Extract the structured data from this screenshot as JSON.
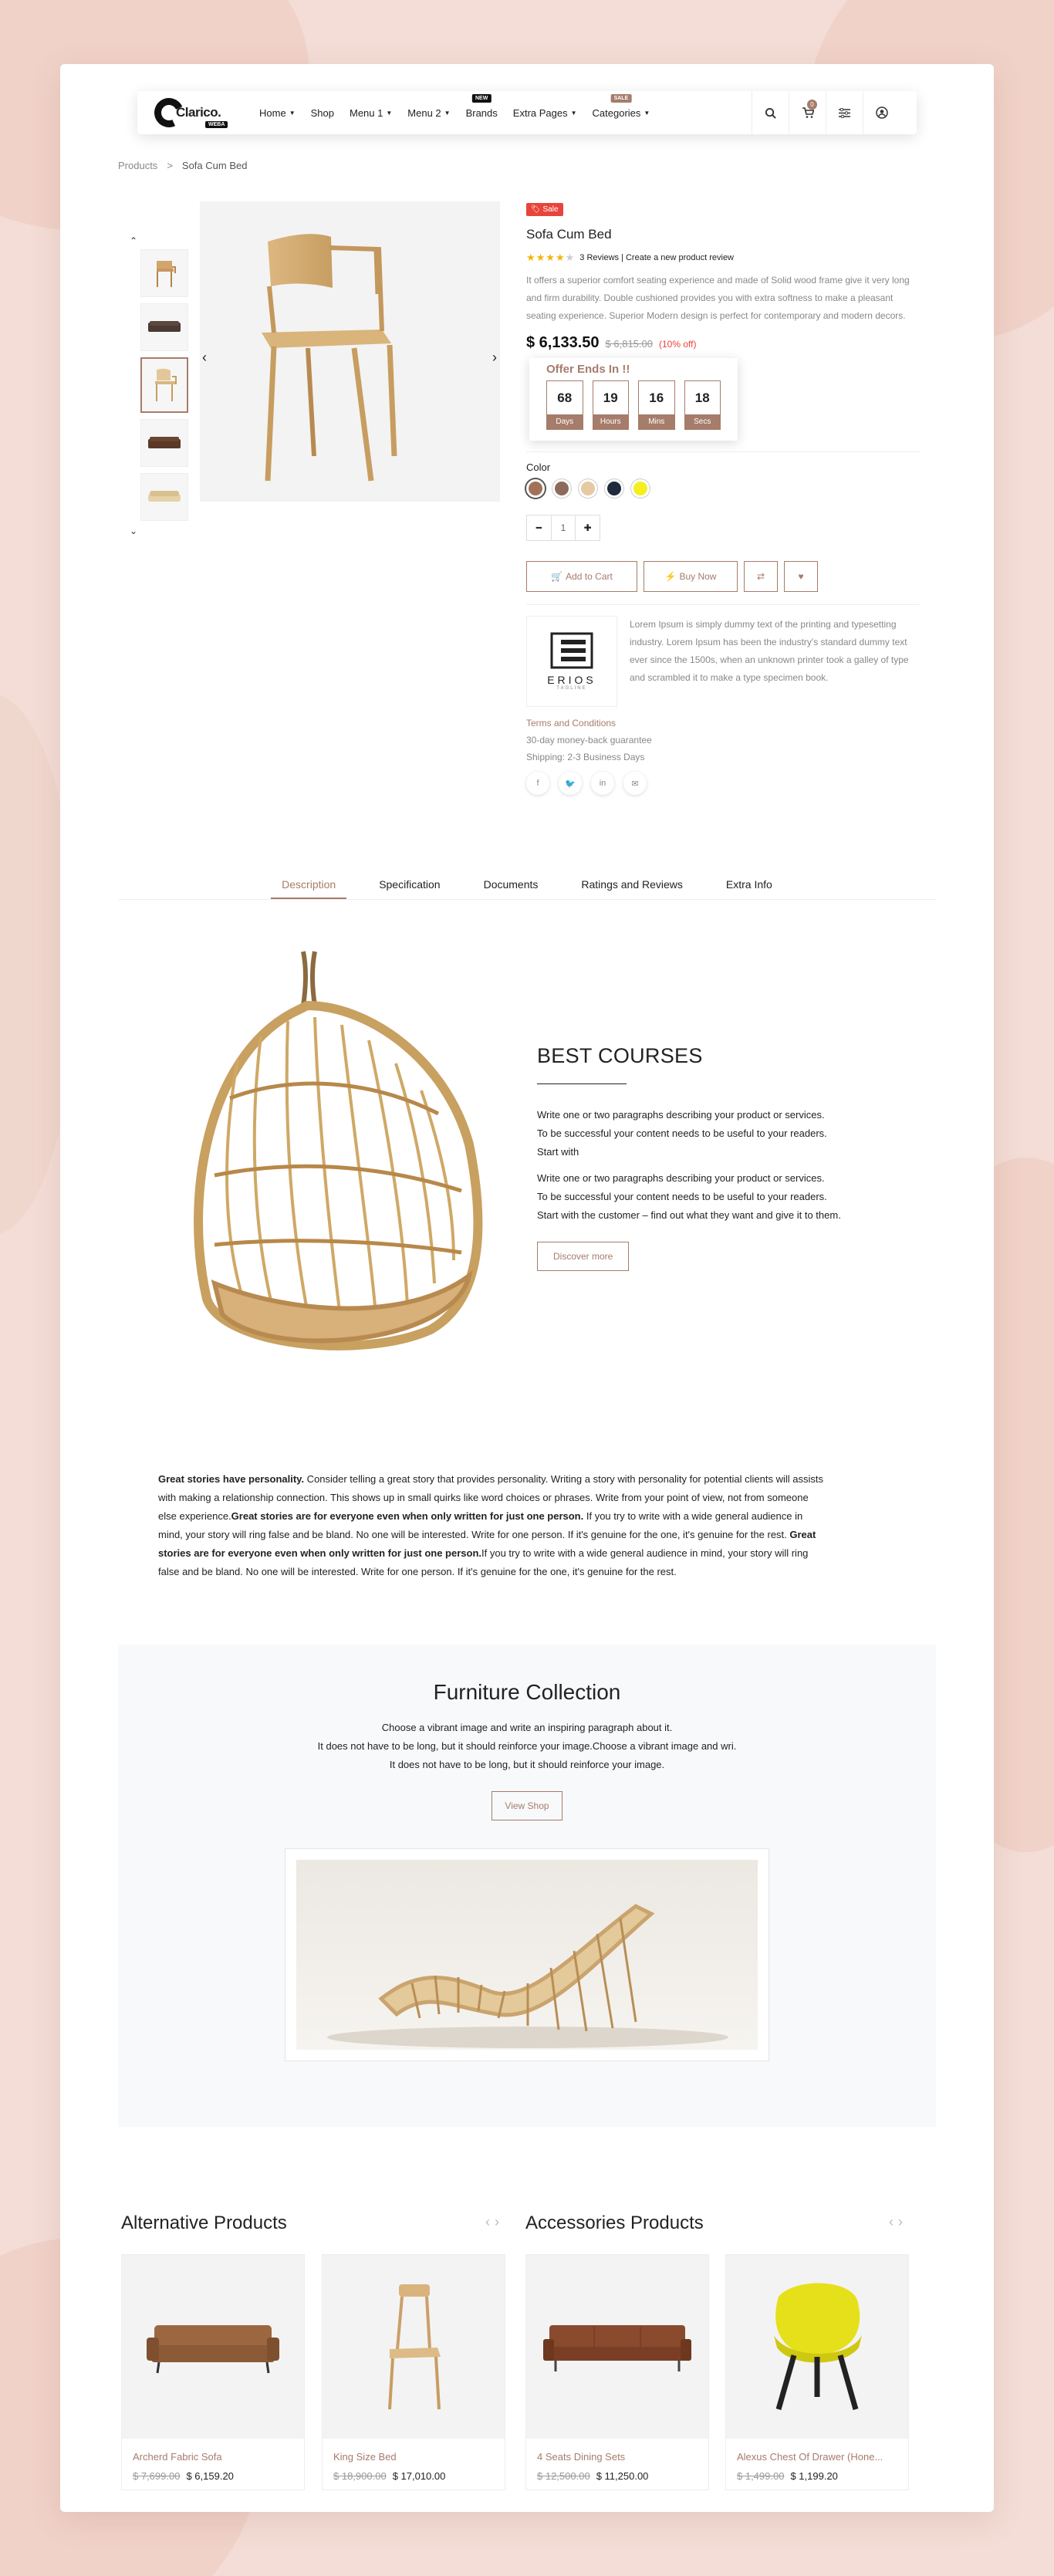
{
  "brand": {
    "name": "Clarico.",
    "badge": "WEBA"
  },
  "nav": {
    "items": [
      {
        "label": "Home",
        "caret": true,
        "tag": ""
      },
      {
        "label": "Shop",
        "caret": false,
        "tag": ""
      },
      {
        "label": "Menu 1",
        "caret": true,
        "tag": ""
      },
      {
        "label": "Menu 2",
        "caret": true,
        "tag": ""
      },
      {
        "label": "Brands",
        "caret": false,
        "tag": "NEW"
      },
      {
        "label": "Extra Pages",
        "caret": true,
        "tag": ""
      },
      {
        "label": "Categories",
        "caret": true,
        "tag": "SALE"
      }
    ],
    "cart_count": "0"
  },
  "breadcrumb": {
    "parent": "Products",
    "current": "Sofa Cum Bed"
  },
  "product": {
    "sale_label": "Sale",
    "name": "Sofa Cum Bed",
    "rating": 4,
    "reviews": "3 Reviews | Create a new product review",
    "description": "It offers a superior comfort seating experience and made of Solid wood frame give it very long and firm durability. Double cushioned provides you with extra softness to make a pleasant seating experience. Superior Modern design is perfect for contemporary and modern decors.",
    "price": "$ 6,133.50",
    "old_price": "$ 6,815.00",
    "discount": "(10% off)",
    "offer_title": "Offer Ends In !!",
    "timer": [
      {
        "value": "68",
        "label": "Days"
      },
      {
        "value": "19",
        "label": "Hours"
      },
      {
        "value": "16",
        "label": "Mins"
      },
      {
        "value": "18",
        "label": "Secs"
      }
    ],
    "color_label": "Color",
    "colors": [
      "#a1715a",
      "#8d6b5c",
      "#e7c9a4",
      "#1f2a3a",
      "#f4ef1e"
    ],
    "quantity": "1",
    "add_to_cart": "Add to Cart",
    "buy_now": "Buy Now",
    "brand_name": "ERIOS",
    "brand_sub": "TAGLINE",
    "brand_text": "Lorem Ipsum is simply dummy text of the printing and typesetting industry. Lorem Ipsum has been the industry's standard dummy text ever since the 1500s, when an unknown printer took a galley of type and scrambled it to make a type specimen book.",
    "terms": "Terms and Conditions",
    "guarantee": "30-day money-back guarantee",
    "shipping": "Shipping: 2-3 Business Days"
  },
  "tabs": [
    "Description",
    "Specification",
    "Documents",
    "Ratings and Reviews",
    "Extra Info"
  ],
  "courses": {
    "title": "BEST COURSES",
    "p1": [
      "Write one or two paragraphs describing your product or services.",
      "To be successful your content needs to be useful to your readers.",
      "Start with"
    ],
    "p2": [
      "Write one or two paragraphs describing your product or services.",
      "To be successful your content needs to be useful to your readers.",
      "Start with the customer – find out what they want and give it to them."
    ],
    "button": "Discover more"
  },
  "story": {
    "b1": "Great stories have personality.",
    "t1": " Consider telling a great story that provides personality. Writing a story with personality for potential clients will assists with making a relationship connection. This shows up in small quirks like word choices or phrases. Write from your point of view, not from someone else experience.",
    "b2": "Great stories are for everyone even when only written for just one person.",
    "t2": " If you try to write with a wide general audience in mind, your story will ring false and be bland. No one will be interested. Write for one person. If it's genuine for the one, it's genuine for the rest. ",
    "b3": "Great stories are for everyone even when only written for just one person.",
    "t3": "If you try to write with a wide general audience in mind, your story will ring false and be bland. No one will be interested. Write for one person. If it's genuine for the one, it's genuine for the rest."
  },
  "collection": {
    "title": "Furniture Collection",
    "lines": [
      "Choose a vibrant image and write an inspiring paragraph about it.",
      "It does not have to be long, but it should reinforce your image.Choose a vibrant image and wri.",
      "It does not have to be long, but it should reinforce your image."
    ],
    "button": "View Shop"
  },
  "alternative": {
    "title": "Alternative Products",
    "items": [
      {
        "name": "Archerd Fabric Sofa",
        "old": "$ 7,699.00",
        "price": "$ 6,159.20"
      },
      {
        "name": "King Size Bed",
        "old": "$ 18,900.00",
        "price": "$ 17,010.00"
      }
    ]
  },
  "accessories": {
    "title": "Accessories Products",
    "items": [
      {
        "name": "4 Seats Dining Sets",
        "old": "$ 12,500.00",
        "price": "$ 11,250.00"
      },
      {
        "name": "Alexus Chest Of Drawer (Hone...",
        "old": "$ 1,499.00",
        "price": "$ 1,199.20"
      }
    ]
  },
  "colors": {
    "accent": "#a67c6b",
    "sale": "#e8443c",
    "star": "#f5b301"
  }
}
